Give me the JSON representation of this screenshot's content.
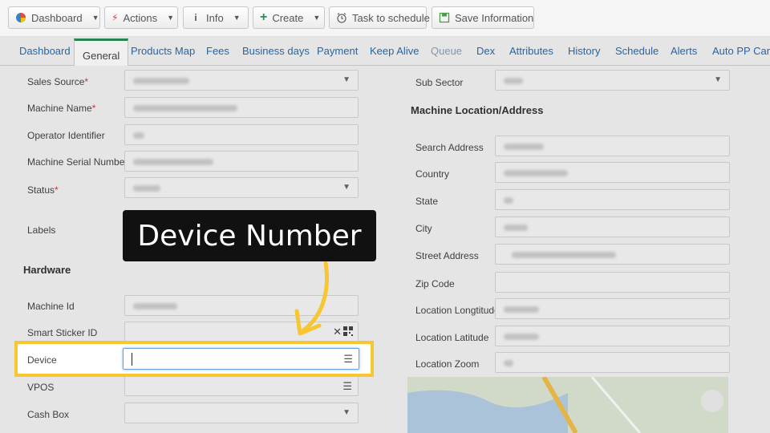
{
  "toolbar": {
    "dashboard": "Dashboard",
    "actions": "Actions",
    "info": "Info",
    "create": "Create",
    "task_to_schedule": "Task to schedule",
    "save_information": "Save Information"
  },
  "tabs": [
    "Dashboard",
    "General",
    "Products Map",
    "Fees",
    "Business days",
    "Payment",
    "Keep Alive",
    "Queue",
    "Dex",
    "Attributes",
    "History",
    "Schedule",
    "Alerts",
    "Auto PP Cards"
  ],
  "left_form": {
    "sales_source": "Sales Source",
    "machine_name": "Machine Name",
    "operator_identifier": "Operator Identifier",
    "machine_serial_number": "Machine Serial Number",
    "status": "Status",
    "labels": "Labels",
    "hardware": "Hardware",
    "machine_id": "Machine Id",
    "smart_sticker_id": "Smart Sticker ID",
    "device": "Device",
    "vpos": "VPOS",
    "cash_box": "Cash Box",
    "required_mark": "*"
  },
  "right_form": {
    "sub_sector": "Sub Sector",
    "location_heading": "Machine Location/Address",
    "search_address": "Search Address",
    "country": "Country",
    "state": "State",
    "city": "City",
    "street_address": "Street Address",
    "zip_code": "Zip Code",
    "location_longtitude": "Location Longtitude",
    "location_latitude": "Location Latitude",
    "location_zoom": "Location Zoom"
  },
  "callout": {
    "text": "Device Number"
  },
  "colors": {
    "highlight": "#f8c630",
    "tab_link": "#2b6cb0",
    "active_tab_accent": "#2e8b57"
  }
}
